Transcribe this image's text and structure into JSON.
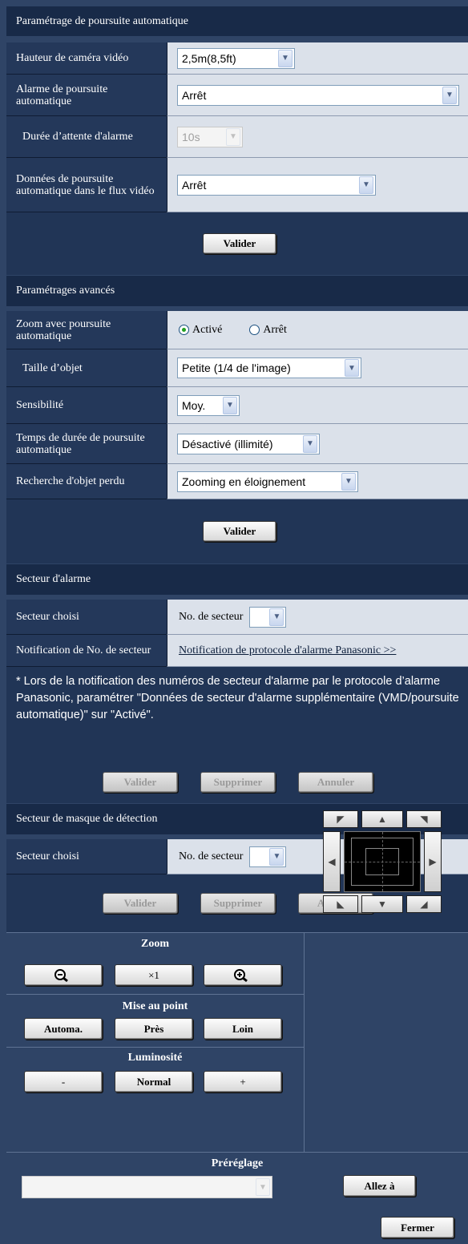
{
  "auto_tracking": {
    "header": "Paramétrage de poursuite automatique",
    "camera_height": {
      "label": "Hauteur de caméra vidéo",
      "value": "2,5m(8,5ft)"
    },
    "tracking_alarm": {
      "label": "Alarme de poursuite automatique",
      "value": "Arrêt"
    },
    "alarm_wait": {
      "label": "Durée d’attente d'alarme",
      "value": "10s"
    },
    "stream_data": {
      "label": "Données de poursuite automatique dans le flux vidéo",
      "value": "Arrêt"
    },
    "submit_label": "Valider"
  },
  "advanced": {
    "header": "Paramétrages avancés",
    "zoom_tracking": {
      "label": "Zoom avec poursuite automatique",
      "option_on": "Activé",
      "option_off": "Arrêt",
      "selected": "Activé"
    },
    "object_size": {
      "label": "Taille d’objet",
      "value": "Petite (1/4 de l'image)"
    },
    "sensitivity": {
      "label": "Sensibilité",
      "value": "Moy."
    },
    "tracking_time": {
      "label": "Temps de durée de poursuite automatique",
      "value": "Désactivé (illimité)"
    },
    "lost_search": {
      "label": "Recherche d'objet perdu",
      "value": "Zooming en éloignement"
    },
    "submit_label": "Valider"
  },
  "alarm_area": {
    "header": "Secteur d'alarme",
    "selected_area": {
      "label": "Secteur choisi",
      "prefix": "No. de secteur",
      "value": ""
    },
    "area_notification": {
      "label": "Notification de No. de secteur",
      "link": "Notification de protocole d'alarme Panasonic >>"
    },
    "note": "* Lors de la notification des numéros de secteur d'alarme par le protocole d’alarme Panasonic, paramétrer \"Données de secteur d'alarme supplémentaire (VMD/poursuite automatique)\" sur \"Activé\".",
    "buttons": {
      "submit": "Valider",
      "delete": "Supprimer",
      "cancel": "Annuler"
    }
  },
  "mask_area": {
    "header": "Secteur de masque de détection",
    "selected_area": {
      "label": "Secteur choisi",
      "prefix": "No. de secteur",
      "value": ""
    },
    "buttons": {
      "submit": "Valider",
      "delete": "Supprimer",
      "cancel": "Annuler"
    }
  },
  "camera_control": {
    "zoom": {
      "title": "Zoom",
      "x1": "×1"
    },
    "focus": {
      "title": "Mise au point",
      "auto": "Automa.",
      "near": "Près",
      "far": "Loin"
    },
    "brightness": {
      "title": "Luminosité",
      "minus": "-",
      "normal": "Normal",
      "plus": "+"
    },
    "preset": {
      "title": "Préréglage",
      "value": "",
      "go_label": "Allez à"
    }
  },
  "close_label": "Fermer"
}
